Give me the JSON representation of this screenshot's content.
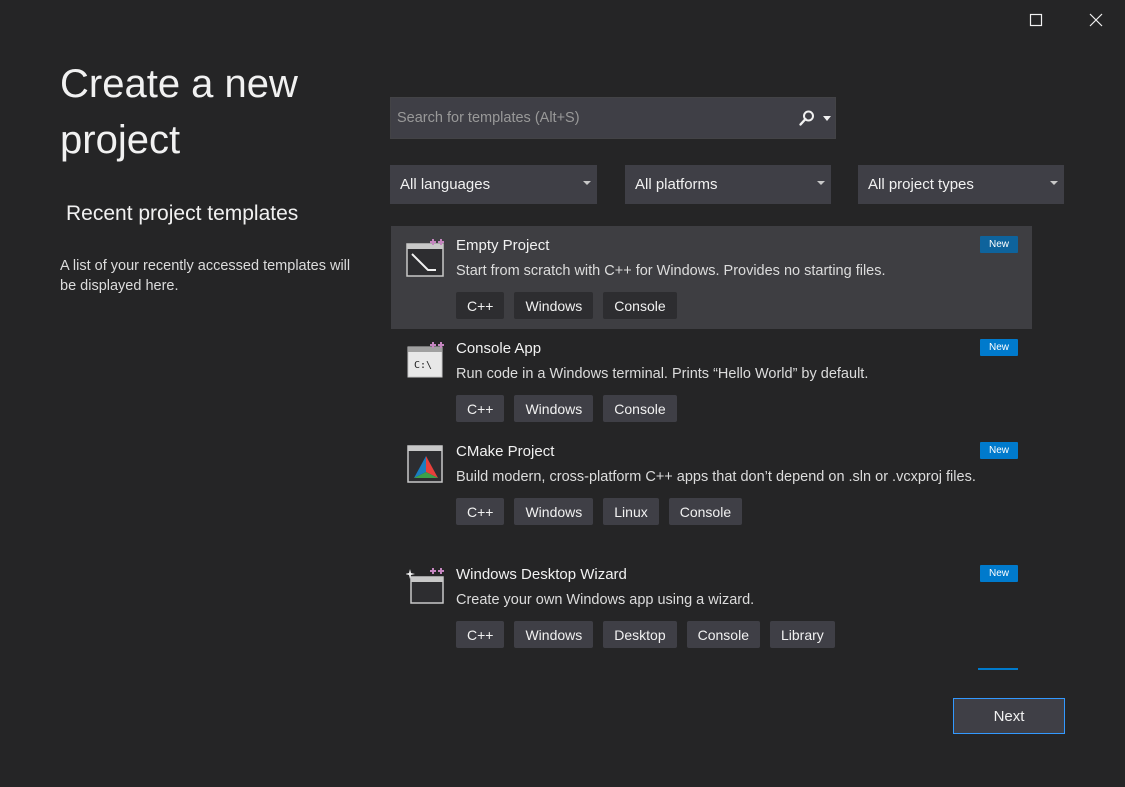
{
  "window": {
    "maximize_icon": "maximize-icon",
    "close_icon": "close-icon"
  },
  "left": {
    "title": "Create a new project",
    "recent_title": "Recent project templates",
    "recent_desc": "A list of your recently accessed templates will be displayed here."
  },
  "search": {
    "placeholder": "Search for templates (Alt+S)",
    "value": ""
  },
  "filters": {
    "language": "All languages",
    "platform": "All platforms",
    "project_type": "All project types"
  },
  "templates": [
    {
      "name": "Empty Project",
      "description": "Start from scratch with C++ for Windows. Provides no starting files.",
      "badge": "New",
      "icon": "empty-project-icon",
      "tags": [
        "C++",
        "Windows",
        "Console"
      ],
      "selected": true
    },
    {
      "name": "Console App",
      "description": "Run code in a Windows terminal. Prints “Hello World” by default.",
      "badge": "New",
      "icon": "console-app-icon",
      "tags": [
        "C++",
        "Windows",
        "Console"
      ],
      "selected": false
    },
    {
      "name": "CMake Project",
      "description": "Build modern, cross-platform C++ apps that don’t depend on .sln or .vcxproj files.",
      "badge": "New",
      "icon": "cmake-project-icon",
      "tags": [
        "C++",
        "Windows",
        "Linux",
        "Console"
      ],
      "selected": false
    },
    {
      "name": "Windows Desktop Wizard",
      "description": "Create your own Windows app using a wizard.",
      "badge": "New",
      "icon": "windows-desktop-wizard-icon",
      "tags": [
        "C++",
        "Windows",
        "Desktop",
        "Console",
        "Library"
      ],
      "selected": false
    }
  ],
  "footer": {
    "next_label": "Next"
  },
  "colors": {
    "background": "#252526",
    "surface": "#3f3f46",
    "selected": "#3e3e42",
    "accent": "#007acc",
    "plus_accent": "#c586c0"
  }
}
